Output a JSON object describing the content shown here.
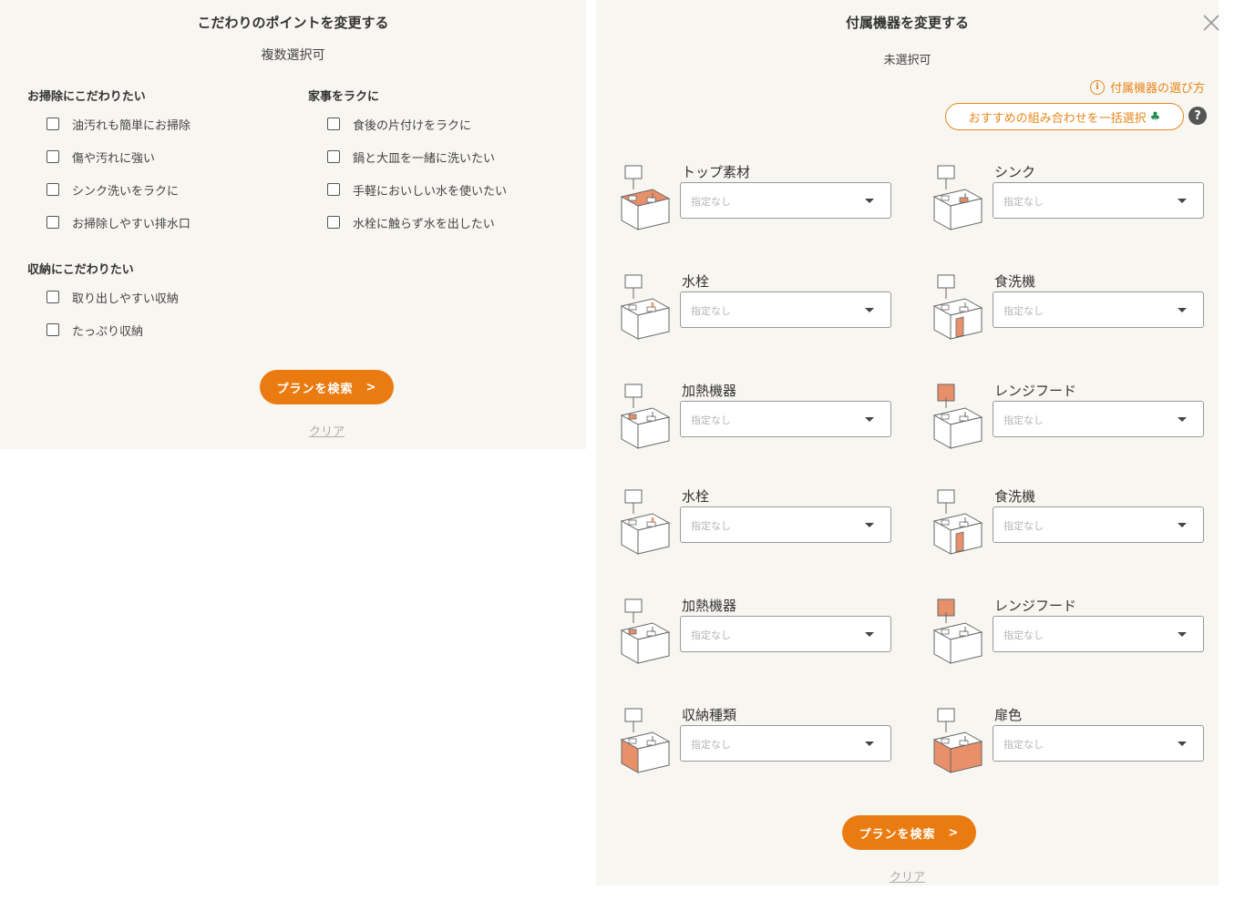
{
  "colors": {
    "accent": "#ea7b10",
    "link": "#e8861a",
    "panel_bg": "#f8f6f1",
    "highlight": "#e8906a"
  },
  "left": {
    "title": "こだわりのポイントを変更する",
    "subtitle": "複数選択可",
    "groups": [
      {
        "title": "お掃除にこだわりたい",
        "items": [
          "油汚れも簡単にお掃除",
          "傷や汚れに強い",
          "シンク洗いをラクに",
          "お掃除しやすい排水口"
        ]
      },
      {
        "title": "家事をラクに",
        "items": [
          "食後の片付けをラクに",
          "鍋と大皿を一緒に洗いたい",
          "手軽においしい水を使いたい",
          "水栓に触らず水を出したい"
        ]
      },
      {
        "title": "収納にこだわりたい",
        "items": [
          "取り出しやすい収納",
          "たっぷり収納"
        ]
      }
    ],
    "search_label": "プランを検索",
    "clear_label": "クリア"
  },
  "right": {
    "title": "付属機器を変更する",
    "subtitle": "未選択可",
    "howto_label": "付属機器の選び方",
    "recommend_label": "おすすめの組み合わせを一括選択",
    "equipment": [
      {
        "label": "トップ素材",
        "placeholder": "指定なし",
        "icon": "kitchen-top-icon"
      },
      {
        "label": "シンク",
        "placeholder": "指定なし",
        "icon": "kitchen-sink-icon"
      },
      {
        "label": "水栓",
        "placeholder": "指定なし",
        "icon": "kitchen-faucet-icon"
      },
      {
        "label": "食洗機",
        "placeholder": "指定なし",
        "icon": "kitchen-dishwasher-icon"
      },
      {
        "label": "加熱機器",
        "placeholder": "指定なし",
        "icon": "kitchen-stove-icon"
      },
      {
        "label": "レンジフード",
        "placeholder": "指定なし",
        "icon": "kitchen-hood-icon"
      },
      {
        "label": "水栓",
        "placeholder": "指定なし",
        "icon": "kitchen-faucet-icon"
      },
      {
        "label": "食洗機",
        "placeholder": "指定なし",
        "icon": "kitchen-dishwasher-icon"
      },
      {
        "label": "加熱機器",
        "placeholder": "指定なし",
        "icon": "kitchen-stove-icon"
      },
      {
        "label": "レンジフード",
        "placeholder": "指定なし",
        "icon": "kitchen-hood-icon"
      },
      {
        "label": "収納種類",
        "placeholder": "指定なし",
        "icon": "kitchen-storage-icon"
      },
      {
        "label": "扉色",
        "placeholder": "指定なし",
        "icon": "kitchen-door-color-icon"
      }
    ],
    "search_label": "プランを検索",
    "clear_label": "クリア"
  }
}
